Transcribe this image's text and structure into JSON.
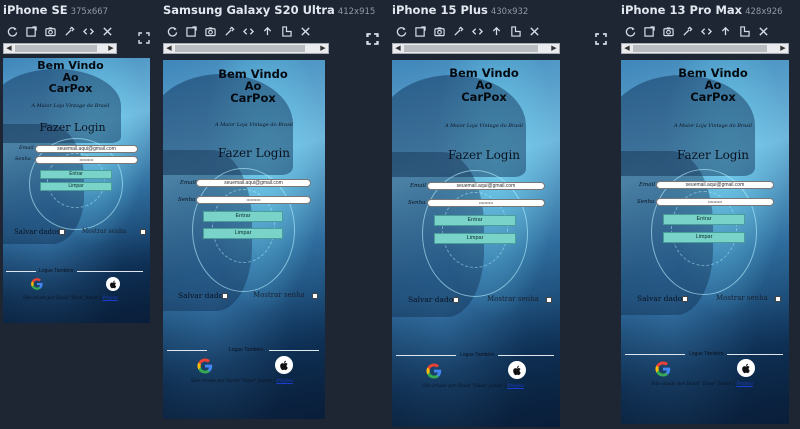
{
  "devices": [
    {
      "name": "iPhone SE",
      "dims": "375x667"
    },
    {
      "name": "Samsung Galaxy S20 Ultra",
      "dims": "412x915"
    },
    {
      "name": "iPhone 15 Plus",
      "dims": "430x932"
    },
    {
      "name": "iPhone 13 Pro Max",
      "dims": "428x926"
    }
  ],
  "toolbar_icons": [
    "rotate-icon",
    "screenshot-icon",
    "camera-icon",
    "color-picker-icon",
    "code-icon",
    "upload-icon",
    "layout-icon",
    "close-icon"
  ],
  "app": {
    "welcome_line1": "Bem Vindo",
    "welcome_line2": "Ao",
    "welcome_line3": "CarPox",
    "tagline": "A Maior Loja Vintage do Brasil",
    "login_title": "Fazer Login",
    "email_label": "Email",
    "email_value": "seuemail.aqui@gmail.com",
    "password_label": "Senha",
    "password_value": "••••••••••",
    "enter_button": "Entrar",
    "clear_button": "Limpar",
    "save_label": "Salvar dados",
    "show_password_label": "Mostrar senha",
    "or_label": "Logue Também",
    "credit_text": "Site criado por David \"Dave\" Junior | ",
    "credit_link": "Projeto"
  },
  "colors": {
    "background": "#1e2633",
    "button": "#79d3c9",
    "link": "#1a3fd0"
  }
}
